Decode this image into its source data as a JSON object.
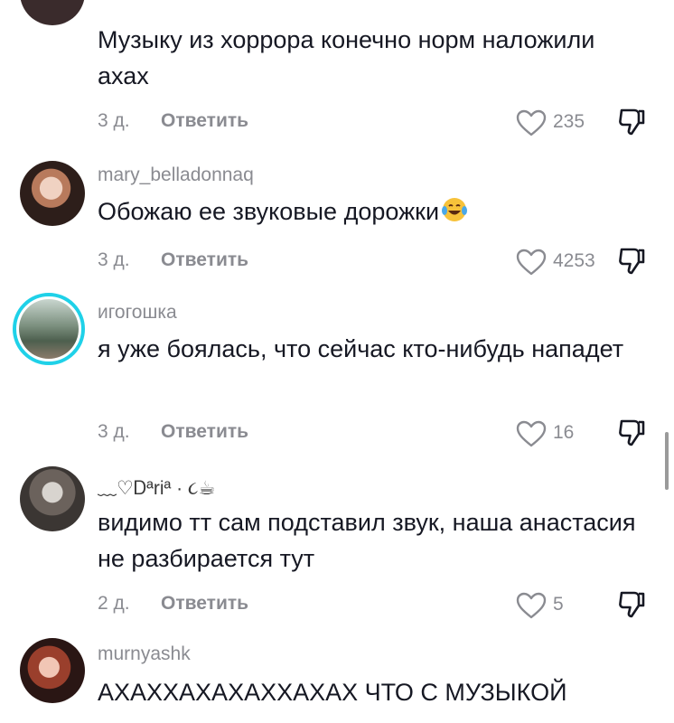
{
  "comments": [
    {
      "username": "",
      "text": "Музыку из хоррора конечно норм наложили ахах",
      "time": "3 д.",
      "reply_label": "Ответить",
      "likes": "235"
    },
    {
      "username": "mary_belladonnaq",
      "text": "Обожаю ее звуковые дорожки",
      "time": "3 д.",
      "reply_label": "Ответить",
      "likes": "4253"
    },
    {
      "username": "игогошка",
      "text": "я уже боялась, что сейчас кто-нибудь нападет",
      "time": "3 д.",
      "reply_label": "Ответить",
      "likes": "16"
    },
    {
      "username": "﹏♡Ꭰªriª · ૮☕",
      "text": "видимо тт сам подставил звук, наша анастасия не разбирается тут",
      "time": "2 д.",
      "reply_label": "Ответить",
      "likes": "5"
    },
    {
      "username": "murnyashk",
      "text": "АХАХХАХАХАХХАХАХ ЧТО С МУЗЫКОЙ"
    }
  ],
  "icons": {
    "like": "heart-outline-icon",
    "dislike": "thumbs-down-icon",
    "emoji": "laughing-tears-emoji"
  },
  "colors": {
    "text": "#161823",
    "secondary": "#8a8b91",
    "story_ring": "#1fd1e8"
  }
}
